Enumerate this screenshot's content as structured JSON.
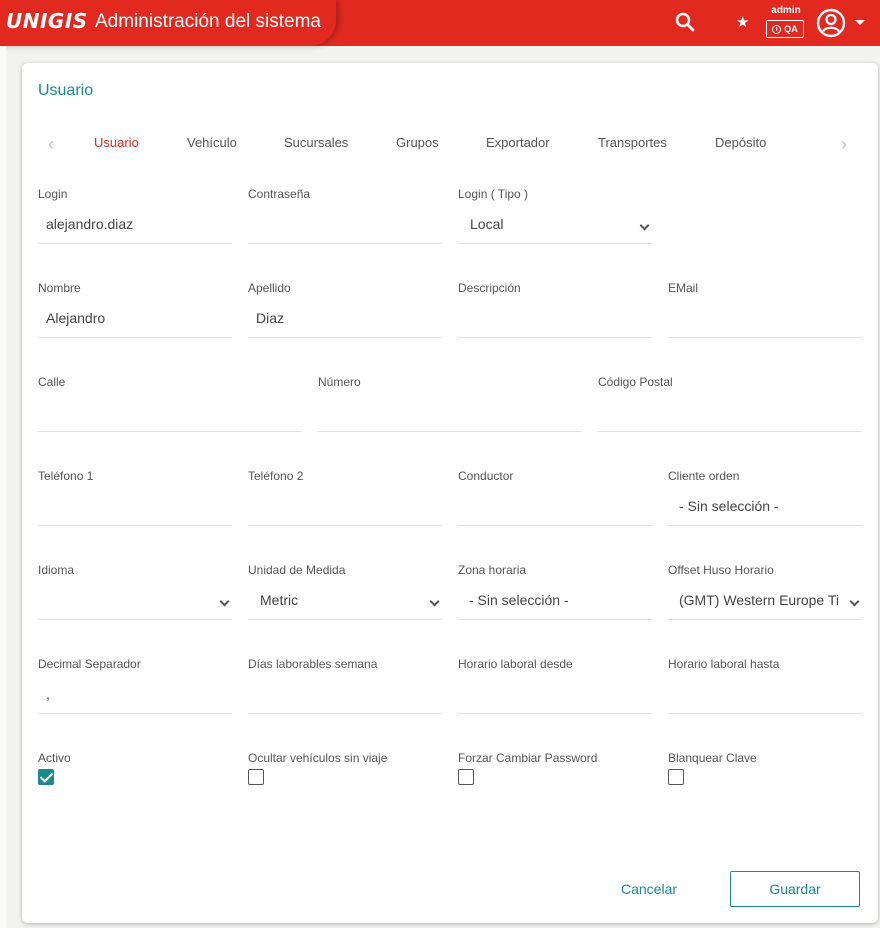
{
  "header": {
    "logo": "UNIGIS",
    "title": "Administración del sistema",
    "user": "admin",
    "env_badge": "QA",
    "env_badge_icon": "i",
    "icons": [
      "search-icon",
      "star-icon",
      "user-avatar-icon",
      "caret-down-icon"
    ]
  },
  "card": {
    "title": "Usuario",
    "tabs": [
      "Usuario",
      "Vehículo",
      "Sucursales",
      "Grupos",
      "Exportador",
      "Transportes",
      "Depósito"
    ],
    "active_tab": "Usuario"
  },
  "form": {
    "login": {
      "label": "Login",
      "value": "alejandro.diaz"
    },
    "password": {
      "label": "Contraseña",
      "value": ""
    },
    "login_type": {
      "label": "Login ( Tipo )",
      "value": "Local"
    },
    "first_name": {
      "label": "Nombre",
      "value": "Alejandro"
    },
    "last_name": {
      "label": "Apellido",
      "value": "Diaz"
    },
    "description": {
      "label": "Descripción",
      "value": ""
    },
    "email": {
      "label": "EMail",
      "value": ""
    },
    "street": {
      "label": "Calle",
      "value": ""
    },
    "number": {
      "label": "Número",
      "value": ""
    },
    "postal_code": {
      "label": "Código Postal",
      "value": ""
    },
    "phone1": {
      "label": "Teléfono 1",
      "value": ""
    },
    "phone2": {
      "label": "Teléfono 2",
      "value": ""
    },
    "driver": {
      "label": "Conductor",
      "value": ""
    },
    "client_order": {
      "label": "Cliente orden",
      "value": "- Sin selección -"
    },
    "language": {
      "label": "Idioma",
      "value": ""
    },
    "unit": {
      "label": "Unidad de Medida",
      "value": "Metric"
    },
    "timezone": {
      "label": "Zona horaria",
      "value": "- Sin selección -"
    },
    "tz_offset": {
      "label": "Offset Huso Horario",
      "value": "(GMT) Western Europe Ti"
    },
    "decimal_sep": {
      "label": "Decimal Separador",
      "value": ","
    },
    "work_days": {
      "label": "Días laborables semana",
      "value": ""
    },
    "work_from": {
      "label": "Horario laboral desde",
      "value": ""
    },
    "work_to": {
      "label": "Horario laboral hasta",
      "value": ""
    },
    "active": {
      "label": "Activo",
      "checked": true
    },
    "hide_vehicles": {
      "label": "Ocultar vehículos sin viaje",
      "checked": false
    },
    "force_pw": {
      "label": "Forzar Cambiar Password",
      "checked": false
    },
    "reset_key": {
      "label": "Blanquear Clave",
      "checked": false
    }
  },
  "actions": {
    "cancel": "Cancelar",
    "save": "Guardar"
  },
  "colors": {
    "header": "#e1291f",
    "accent": "#1a8a8f"
  }
}
